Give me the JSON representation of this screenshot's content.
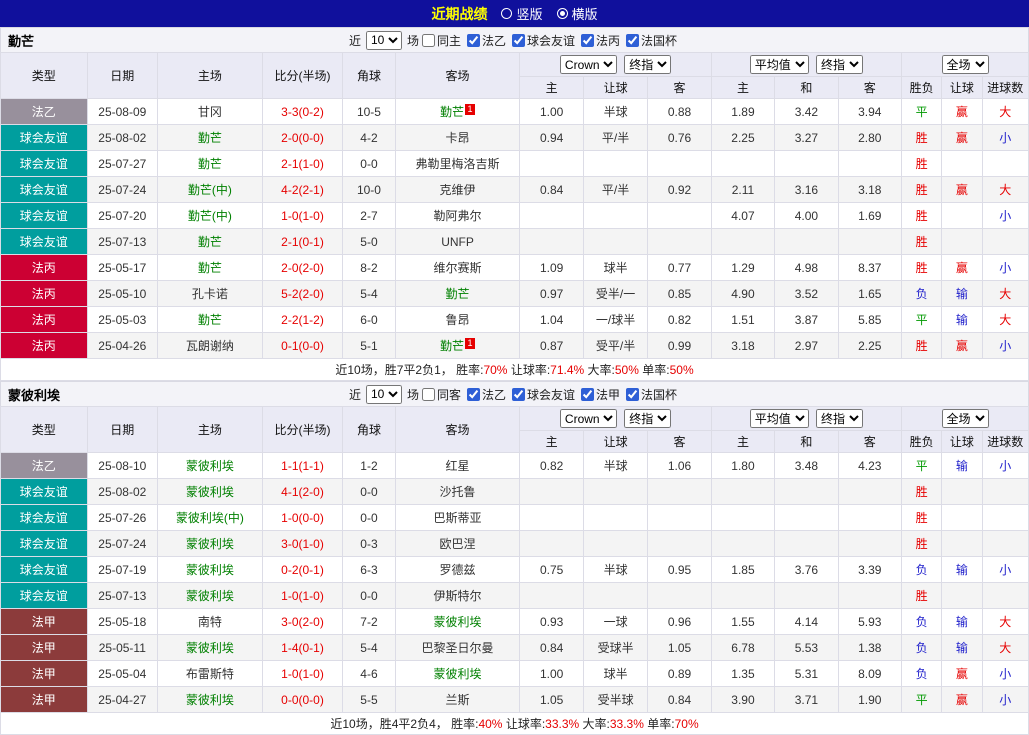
{
  "topbar": {
    "title": "近期战绩",
    "vertical_label": "竖版",
    "horizontal_label": "横版"
  },
  "table_headers": {
    "type": "类型",
    "date": "日期",
    "home": "主场",
    "score": "比分(半场)",
    "corner": "角球",
    "away": "客场",
    "asian_cols": [
      "主",
      "让球",
      "客"
    ],
    "euro_cols": [
      "主",
      "和",
      "客"
    ],
    "result_cols": [
      "胜负",
      "让球",
      "进球数"
    ],
    "odds_source": "Crown",
    "final_label": "终指",
    "average_label": "平均值",
    "scope_label": "全场"
  },
  "league_colors": {
    "法乙": "#98909C",
    "球会友谊": "#009E9E",
    "法丙": "#CC0033",
    "法甲": "#8C3B3B"
  },
  "result_colors": {
    "胜": "#E60000",
    "平": "#009900",
    "负": "#2222CC"
  },
  "mark_colors": {
    "赢": "#E60000",
    "输": "#2222CC",
    "大": "#E60000",
    "小": "#2222CC"
  },
  "sections": [
    {
      "team": "勤芒",
      "filter": {
        "near_label": "近",
        "count": "10",
        "matches_label": "场",
        "same_venue_label": "同主",
        "leagues": [
          "法乙",
          "球会友谊",
          "法丙",
          "法国杯"
        ]
      },
      "rows": [
        {
          "lg": "法乙",
          "date": "25-08-09",
          "home": "甘冈",
          "hG": false,
          "hN": "",
          "score": "3-3(0-2)",
          "cor": "10-5",
          "away": "勤芒",
          "aG": true,
          "aN": "1",
          "ah": [
            "1.00",
            "半球",
            "0.88"
          ],
          "eu": [
            "1.89",
            "3.42",
            "3.94"
          ],
          "res": "平",
          "hr": "赢",
          "gl": "大"
        },
        {
          "lg": "球会友谊",
          "date": "25-08-02",
          "home": "勤芒",
          "hG": true,
          "hN": "",
          "score": "2-0(0-0)",
          "cor": "4-2",
          "away": "卡昂",
          "aG": false,
          "aN": "",
          "ah": [
            "0.94",
            "平/半",
            "0.76"
          ],
          "eu": [
            "2.25",
            "3.27",
            "2.80"
          ],
          "res": "胜",
          "hr": "赢",
          "gl": "小"
        },
        {
          "lg": "球会友谊",
          "date": "25-07-27",
          "home": "勤芒",
          "hG": true,
          "hN": "",
          "score": "2-1(1-0)",
          "cor": "0-0",
          "away": "弗勒里梅洛吉斯",
          "aG": false,
          "aN": "",
          "ah": [
            "",
            "",
            ""
          ],
          "eu": [
            "",
            "",
            ""
          ],
          "res": "胜",
          "hr": "",
          "gl": ""
        },
        {
          "lg": "球会友谊",
          "date": "25-07-24",
          "home": "勤芒(中)",
          "hG": true,
          "hN": "",
          "score": "4-2(2-1)",
          "cor": "10-0",
          "away": "克维伊",
          "aG": false,
          "aN": "",
          "ah": [
            "0.84",
            "平/半",
            "0.92"
          ],
          "eu": [
            "2.11",
            "3.16",
            "3.18"
          ],
          "res": "胜",
          "hr": "赢",
          "gl": "大"
        },
        {
          "lg": "球会友谊",
          "date": "25-07-20",
          "home": "勤芒(中)",
          "hG": true,
          "hN": "",
          "score": "1-0(1-0)",
          "cor": "2-7",
          "away": "勒阿弗尔",
          "aG": false,
          "aN": "",
          "ah": [
            "",
            "",
            ""
          ],
          "eu": [
            "4.07",
            "4.00",
            "1.69"
          ],
          "res": "胜",
          "hr": "",
          "gl": "小"
        },
        {
          "lg": "球会友谊",
          "date": "25-07-13",
          "home": "勤芒",
          "hG": true,
          "hN": "",
          "score": "2-1(0-1)",
          "cor": "5-0",
          "away": "UNFP",
          "aG": false,
          "aN": "",
          "ah": [
            "",
            "",
            ""
          ],
          "eu": [
            "",
            "",
            ""
          ],
          "res": "胜",
          "hr": "",
          "gl": ""
        },
        {
          "lg": "法丙",
          "date": "25-05-17",
          "home": "勤芒",
          "hG": true,
          "hN": "",
          "score": "2-0(2-0)",
          "cor": "8-2",
          "away": "维尔赛斯",
          "aG": false,
          "aN": "",
          "ah": [
            "1.09",
            "球半",
            "0.77"
          ],
          "eu": [
            "1.29",
            "4.98",
            "8.37"
          ],
          "res": "胜",
          "hr": "赢",
          "gl": "小"
        },
        {
          "lg": "法丙",
          "date": "25-05-10",
          "home": "孔卡诺",
          "hG": false,
          "hN": "",
          "score": "5-2(2-0)",
          "cor": "5-4",
          "away": "勤芒",
          "aG": true,
          "aN": "",
          "ah": [
            "0.97",
            "受半/一",
            "0.85"
          ],
          "eu": [
            "4.90",
            "3.52",
            "1.65"
          ],
          "res": "负",
          "hr": "输",
          "gl": "大"
        },
        {
          "lg": "法丙",
          "date": "25-05-03",
          "home": "勤芒",
          "hG": true,
          "hN": "",
          "score": "2-2(1-2)",
          "cor": "6-0",
          "away": "鲁昂",
          "aG": false,
          "aN": "",
          "ah": [
            "1.04",
            "一/球半",
            "0.82"
          ],
          "eu": [
            "1.51",
            "3.87",
            "5.85"
          ],
          "res": "平",
          "hr": "输",
          "gl": "大"
        },
        {
          "lg": "法丙",
          "date": "25-04-26",
          "home": "瓦朗谢纳",
          "hG": false,
          "hN": "",
          "score": "0-1(0-0)",
          "cor": "5-1",
          "away": "勤芒",
          "aG": true,
          "aN": "1",
          "ah": [
            "0.87",
            "受平/半",
            "0.99"
          ],
          "eu": [
            "3.18",
            "2.97",
            "2.25"
          ],
          "res": "胜",
          "hr": "赢",
          "gl": "小"
        }
      ],
      "summary": {
        "prefix": "近10场，胜7平2负1，",
        "stats": [
          [
            "胜率:",
            "70%"
          ],
          [
            "让球率:",
            "71.4%"
          ],
          [
            "大率:",
            "50%"
          ],
          [
            "单率:",
            "50%"
          ]
        ]
      }
    },
    {
      "team": "蒙彼利埃",
      "filter": {
        "near_label": "近",
        "count": "10",
        "matches_label": "场",
        "same_venue_label": "同客",
        "leagues": [
          "法乙",
          "球会友谊",
          "法甲",
          "法国杯"
        ]
      },
      "rows": [
        {
          "lg": "法乙",
          "date": "25-08-10",
          "home": "蒙彼利埃",
          "hG": true,
          "hN": "",
          "score": "1-1(1-1)",
          "cor": "1-2",
          "away": "红星",
          "aG": false,
          "aN": "",
          "ah": [
            "0.82",
            "半球",
            "1.06"
          ],
          "eu": [
            "1.80",
            "3.48",
            "4.23"
          ],
          "res": "平",
          "hr": "输",
          "gl": "小"
        },
        {
          "lg": "球会友谊",
          "date": "25-08-02",
          "home": "蒙彼利埃",
          "hG": true,
          "hN": "",
          "score": "4-1(2-0)",
          "cor": "0-0",
          "away": "沙托鲁",
          "aG": false,
          "aN": "",
          "ah": [
            "",
            "",
            ""
          ],
          "eu": [
            "",
            "",
            ""
          ],
          "res": "胜",
          "hr": "",
          "gl": ""
        },
        {
          "lg": "球会友谊",
          "date": "25-07-26",
          "home": "蒙彼利埃(中)",
          "hG": true,
          "hN": "",
          "score": "1-0(0-0)",
          "cor": "0-0",
          "away": "巴斯蒂亚",
          "aG": false,
          "aN": "",
          "ah": [
            "",
            "",
            ""
          ],
          "eu": [
            "",
            "",
            ""
          ],
          "res": "胜",
          "hr": "",
          "gl": ""
        },
        {
          "lg": "球会友谊",
          "date": "25-07-24",
          "home": "蒙彼利埃",
          "hG": true,
          "hN": "",
          "score": "3-0(1-0)",
          "cor": "0-3",
          "away": "欧巴涅",
          "aG": false,
          "aN": "",
          "ah": [
            "",
            "",
            ""
          ],
          "eu": [
            "",
            "",
            ""
          ],
          "res": "胜",
          "hr": "",
          "gl": ""
        },
        {
          "lg": "球会友谊",
          "date": "25-07-19",
          "home": "蒙彼利埃",
          "hG": true,
          "hN": "",
          "score": "0-2(0-1)",
          "cor": "6-3",
          "away": "罗德兹",
          "aG": false,
          "aN": "",
          "ah": [
            "0.75",
            "半球",
            "0.95"
          ],
          "eu": [
            "1.85",
            "3.76",
            "3.39"
          ],
          "res": "负",
          "hr": "输",
          "gl": "小"
        },
        {
          "lg": "球会友谊",
          "date": "25-07-13",
          "home": "蒙彼利埃",
          "hG": true,
          "hN": "",
          "score": "1-0(1-0)",
          "cor": "0-0",
          "away": "伊斯特尔",
          "aG": false,
          "aN": "",
          "ah": [
            "",
            "",
            ""
          ],
          "eu": [
            "",
            "",
            ""
          ],
          "res": "胜",
          "hr": "",
          "gl": ""
        },
        {
          "lg": "法甲",
          "date": "25-05-18",
          "home": "南特",
          "hG": false,
          "hN": "",
          "score": "3-0(2-0)",
          "cor": "7-2",
          "away": "蒙彼利埃",
          "aG": true,
          "aN": "",
          "ah": [
            "0.93",
            "一球",
            "0.96"
          ],
          "eu": [
            "1.55",
            "4.14",
            "5.93"
          ],
          "res": "负",
          "hr": "输",
          "gl": "大"
        },
        {
          "lg": "法甲",
          "date": "25-05-11",
          "home": "蒙彼利埃",
          "hG": true,
          "hN": "",
          "score": "1-4(0-1)",
          "cor": "5-4",
          "away": "巴黎圣日尔曼",
          "aG": false,
          "aN": "",
          "ah": [
            "0.84",
            "受球半",
            "1.05"
          ],
          "eu": [
            "6.78",
            "5.53",
            "1.38"
          ],
          "res": "负",
          "hr": "输",
          "gl": "大"
        },
        {
          "lg": "法甲",
          "date": "25-05-04",
          "home": "布雷斯特",
          "hG": false,
          "hN": "",
          "score": "1-0(1-0)",
          "cor": "4-6",
          "away": "蒙彼利埃",
          "aG": true,
          "aN": "",
          "ah": [
            "1.00",
            "球半",
            "0.89"
          ],
          "eu": [
            "1.35",
            "5.31",
            "8.09"
          ],
          "res": "负",
          "hr": "赢",
          "gl": "小"
        },
        {
          "lg": "法甲",
          "date": "25-04-27",
          "home": "蒙彼利埃",
          "hG": true,
          "hN": "",
          "score": "0-0(0-0)",
          "cor": "5-5",
          "away": "兰斯",
          "aG": false,
          "aN": "",
          "ah": [
            "1.05",
            "受半球",
            "0.84"
          ],
          "eu": [
            "3.90",
            "3.71",
            "1.90"
          ],
          "res": "平",
          "hr": "赢",
          "gl": "小"
        }
      ],
      "summary": {
        "prefix": "近10场，胜4平2负4，",
        "stats": [
          [
            "胜率:",
            "40%"
          ],
          [
            "让球率:",
            "33.3%"
          ],
          [
            "大率:",
            "33.3%"
          ],
          [
            "单率:",
            "70%"
          ]
        ]
      }
    }
  ]
}
